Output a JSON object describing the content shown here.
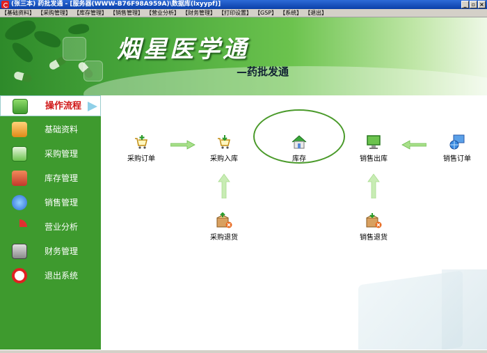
{
  "window": {
    "title": "(张三本) 药批发通 - [服务器(WWW-B76F98A959A)\\数据库(lxyypf)]",
    "minimize": "_",
    "restore": "▫",
    "close": "×"
  },
  "menu": [
    "【基础资料】",
    "【采购管理】",
    "【库存管理】",
    "【销售管理】",
    "【营业分析】",
    "【财务管理】",
    "【打印设置】",
    "【GSP】",
    "【系统】",
    "【退出】"
  ],
  "banner": {
    "logo_title": "烟星医学通",
    "logo_subtitle": "—药批发通"
  },
  "sidebar": {
    "active_label": "操作流程",
    "items": [
      "基础资料",
      "采购管理",
      "库存管理",
      "销售管理",
      "营业分析",
      "财务管理",
      "退出系统"
    ]
  },
  "flow": {
    "purchase_order": "采购订单",
    "purchase_in": "采购入库",
    "stock": "库存",
    "sales_out": "销售出库",
    "sales_order": "销售订单",
    "purchase_return": "采购退货",
    "sales_return": "销售退货"
  }
}
